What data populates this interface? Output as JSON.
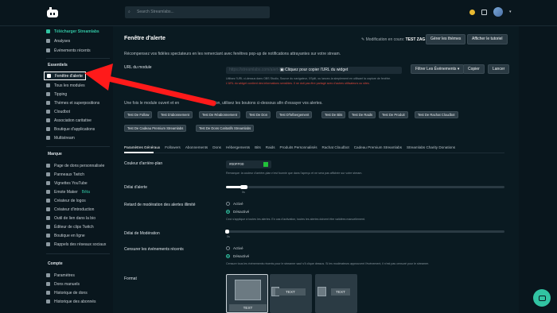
{
  "header": {
    "search_placeholder": "Search Streamlabs...",
    "icons": [
      "streamlabs-logo",
      "search-icon",
      "notification-icon",
      "avatar"
    ]
  },
  "sidebar": {
    "top_items": [
      {
        "label": "Télécharger Streamlabs",
        "icon": "download-icon"
      },
      {
        "label": "Analyses",
        "icon": "chart-icon"
      },
      {
        "label": "Événements récents",
        "icon": "list-icon"
      }
    ],
    "sections": {
      "essentiels": "Essentiels",
      "marque": "Marque",
      "compte": "Compte"
    },
    "essentiels_items": [
      "Fenêtre d'alerte",
      "Tous les modules",
      "Tipping",
      "Thèmes et superpositions",
      "Cloudbot",
      "Association caritative",
      "Boutique d'applications",
      "Multistream"
    ],
    "marque_items": [
      "Page de dons personnalisée",
      "Panneaux Twitch",
      "Vignettes YouTube",
      "Emote Maker",
      "Créateur de logos",
      "Créateur d'introduction",
      "Outil de lien dans la bio",
      "Éditeur de clips Twitch",
      "Boutique en ligne",
      "Rappels des réseaux sociaux"
    ],
    "emote_beta": "Bêta",
    "compte_items": [
      "Paramètres",
      "Dons manuels",
      "Historique de dons",
      "Historique des abonnés"
    ]
  },
  "main": {
    "title": "Fenêtre d'alerte",
    "modification_label": "Modification en cours:",
    "modification_value": "TEST ZAG",
    "btn_themes": "Gérer les thèmes",
    "btn_tutorial": "Afficher le tutoriel",
    "intro": "Récompensez vos fidèles spectateurs en les remerciant avec fenêtres pop-up de notifications attrayantes sur votre stream.",
    "url_label": "URL du module",
    "url_value": "https://streamlabs.com/alert-box/v3/...",
    "url_hint": "Cliquez pour copier l'URL du widget",
    "btn_filter": "Filtrer Les Événements",
    "btn_copy": "Copier",
    "btn_launch": "Lancer",
    "url_note_1": "Utilisez l'URL ci-dessus dans OBS Studio, Source du navigateur, XSplit, ou lancez-la simplement en utilisant la capture de fenêtre.",
    "url_note_2": "L'URL du widget contient des informations sensibles. Il ne doit pas être partagé avec d'autres utilisateurs ou sites.",
    "test_intro_a": "Une fois le module ouvert et en",
    "test_intro_b": "sation, utilisez les boutons ci-dessous afin d'essayer vos alertes.",
    "test_buttons_row1": [
      "Test De Follow",
      "Test D'abonnement",
      "Test De Réabonnement",
      "Test De Don",
      "Test D'hébergement",
      "Test De Bits",
      "Test De Raids",
      "Test De Produit",
      "Test De Rachat Cloudbot"
    ],
    "test_buttons_row2": [
      "Test De Cadeau Premium Streamlabs",
      "Test De Dons Caritatifs Streamlabs"
    ],
    "tabs": [
      "Paramètres Généraux",
      "Followers",
      "Abonnements",
      "Dons",
      "Hébergements",
      "Bits",
      "Raids",
      "Produits Personnalisés",
      "Rachat Cloudbot",
      "Cadeau Premium Streamlabs",
      "Streamlabs Charity Donations"
    ],
    "color_label": "Couleur d'arrière-plan",
    "color_value": "#00FF00",
    "color_swatch": "#22c23a",
    "color_note": "Remarque: la couleur d'arrière-plan n'est fournie que dans l'aperçu et ne sera pas affichée sur votre stream.",
    "delay_label": "Délai d'alerte",
    "delay_value": "0s",
    "moderation_label": "Retard de modération des alertes illimité",
    "moderation_active": "Activé",
    "moderation_inactive": "Désactivé",
    "moderation_note": "Ceci s'applique à toutes les alertes. En cas d'activation, toutes les alertes doivent être validées manuellement.",
    "mod_delay_label": "Délai de Modération",
    "mod_delay_value": "0s",
    "recent_label": "Censurer les événements récents",
    "recent_active": "Activé",
    "recent_inactive": "Désactivé",
    "recent_note": "Censure tous les événements récents pour le streamer sauf s'il clique dessus. Si les modérateurs approuvent l'événement, il n'est pas censuré pour le streamer.",
    "format_label": "Format",
    "format_cards": [
      "TEXT",
      "TEXT",
      "TEXT"
    ]
  },
  "annotation": {
    "arrow_color": "#ff1a1a"
  },
  "colors": {
    "accent": "#31c3a2",
    "bg": "#09161d"
  }
}
